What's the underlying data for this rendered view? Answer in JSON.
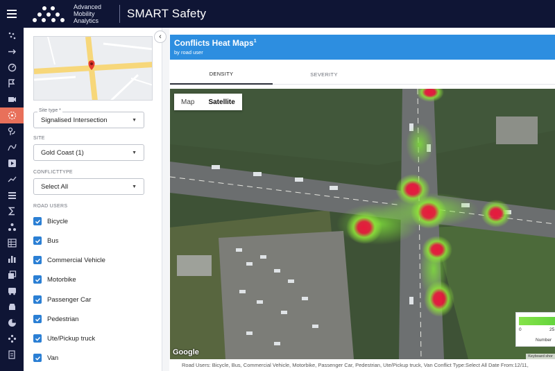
{
  "brand": {
    "logo_line1": "Advanced",
    "logo_line2": "Mobility",
    "logo_line3": "Analytics",
    "app_title": "SMART Safety"
  },
  "rail": {
    "icons": [
      "menu-icon",
      "scatter-icon",
      "arrow-right-icon",
      "speedometer-icon",
      "route-flag-icon",
      "camera-icon",
      "conflict-target-icon",
      "location-route-icon",
      "curve-icon",
      "video-play-icon",
      "trend-icon",
      "layers-icon",
      "sigma-icon",
      "nodes-icon",
      "table-icon",
      "bar-chart-icon",
      "copy-icon",
      "bus-icon",
      "vehicle-front-icon",
      "pie-chart-icon",
      "gamepad-icon",
      "file-export-icon"
    ],
    "active_index": 6
  },
  "filters": {
    "site_type_label": "Site type *",
    "site_type_value": "Signalised Intersection",
    "site_label": "SITE",
    "site_value": "Gold Coast (1)",
    "conflict_type_label": "CONFLICTTYPE",
    "conflict_type_value": "Select All",
    "road_users_label": "ROAD USERS",
    "road_users": [
      "Bicycle",
      "Bus",
      "Commercial Vehicle",
      "Motorbike",
      "Passenger Car",
      "Pedestrian",
      "Ute/Pickup truck",
      "Van"
    ]
  },
  "card": {
    "title": "Conflicts Heat Maps",
    "title_sup": "1",
    "subtitle": "by road user",
    "tabs": [
      "DENSITY",
      "SEVERITY"
    ],
    "active_tab": 0
  },
  "map": {
    "type_map": "Map",
    "type_satellite": "Satellite",
    "google": "Google",
    "keyboard": "Keyboard shor",
    "legend_min": "0",
    "legend_mid": "25",
    "legend_label": "Number"
  },
  "footer": "Road Users: Bicycle, Bus, Commercial Vehicle, Motorbike, Passenger Car, Pedestrian, Ute/Pickup truck, Van Conflict Type:Select All Date From:12/11,",
  "colors": {
    "nav_bg": "#0f1535",
    "accent": "#e8705a",
    "header_blue": "#2d8ee0",
    "check_blue": "#2b7fd4"
  }
}
